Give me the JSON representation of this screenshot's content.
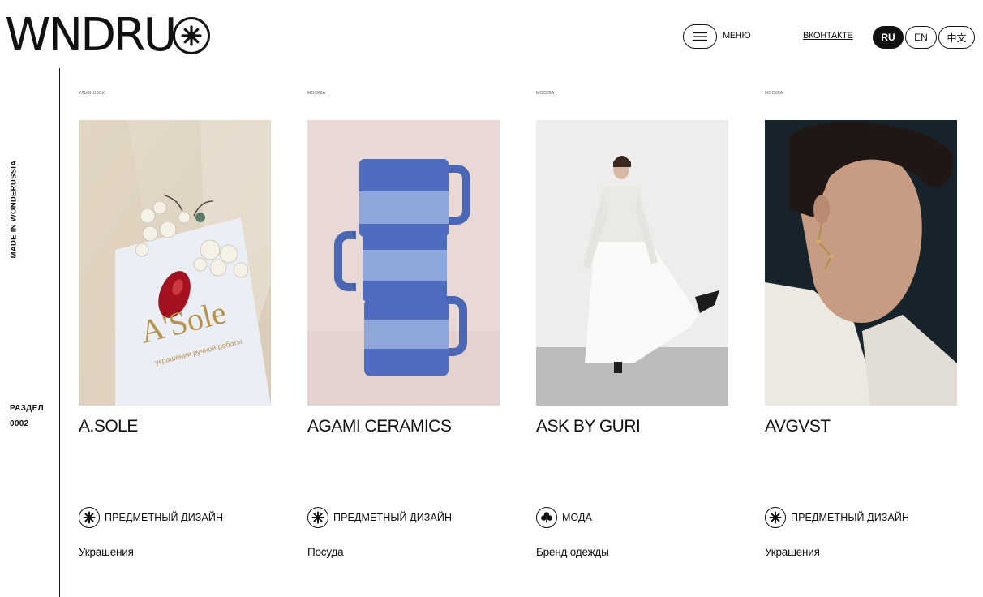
{
  "header": {
    "logo_text": "WNDRU",
    "logo_icon": "asterisk-icon",
    "menu_label": "МЕНЮ",
    "menu_icon": "hamburger-icon",
    "vk_link": "ВКОНТАКТЕ",
    "languages": [
      {
        "label": "RU",
        "active": true
      },
      {
        "label": "EN",
        "active": false
      },
      {
        "label": "中文",
        "active": false
      }
    ]
  },
  "rail": {
    "vertical_text": "MADE IN WONDERUSSIA",
    "section_label": "РАЗДЕЛ",
    "section_number": "0002"
  },
  "cards": [
    {
      "city": "Ульяновск",
      "brand": "A.SOLE",
      "category": "ПРЕДМЕТНЫЙ ДИЗАЙН",
      "category_icon": "asterisk-icon",
      "subtitle": "Украшения",
      "photo_text": "A'Sole",
      "photo_subtext": "украшения ручной работы"
    },
    {
      "city": "Москва",
      "brand": "AGAMI CERAMICS",
      "category": "ПРЕДМЕТНЫЙ ДИЗАЙН",
      "category_icon": "asterisk-icon",
      "subtitle": "Посуда"
    },
    {
      "city": "Москва",
      "brand": "ASK BY GURI",
      "category": "МОДА",
      "category_icon": "clover-icon",
      "subtitle": "Бренд одежды"
    },
    {
      "city": "Москва",
      "brand": "AVGVST",
      "category": "ПРЕДМЕТНЫЙ ДИЗАЙН",
      "category_icon": "asterisk-icon",
      "subtitle": "Украшения"
    }
  ],
  "colors": {
    "accent": "#111111",
    "background": "#ffffff"
  }
}
